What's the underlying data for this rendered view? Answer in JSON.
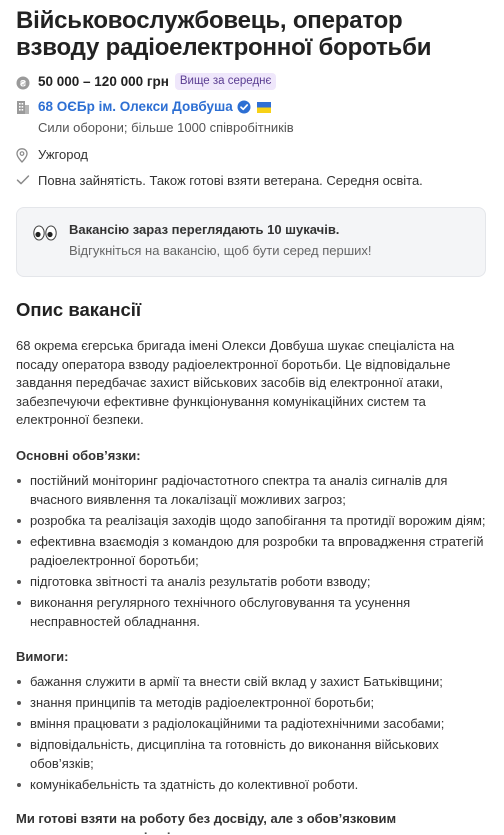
{
  "job": {
    "title": "Військовослужбовець, оператор взводу радіоелектронної боротьби",
    "salary": "50 000 – 120 000 грн",
    "salary_badge": "Вище за середнє",
    "company_name": "68 ОЄБр ім. Олекси Довбуша",
    "company_details": "Сили оборони; більше 1000 співробітників",
    "city": "Ужгород",
    "employment": "Повна зайнятість. Також готові взяти ветерана. Середня освіта."
  },
  "notice": {
    "title": "Вакансію зараз переглядають 10 шукачів.",
    "subtitle": "Відгукніться на вакансію, щоб бути серед перших!"
  },
  "description": {
    "heading": "Опис вакансії",
    "intro": "68 окрема єгерська бригада імені Олекси Довбуша шукає спеціаліста на посаду оператора взводу радіоелектронної боротьби. Це відповідальне завдання передбачає захист військових засобів від електронної атаки, забезпечуючи ефективне функціонування комунікаційних систем та електронної безпеки.",
    "duties_heading": "Основні обов’язки:",
    "duties": [
      "постійний моніторинг радіочастотного спектра та аналіз сигналів для вчасного виявлення та локалізації можливих загроз;",
      "розробка та реалізація заходів щодо запобігання та протидії ворожим діям;",
      "ефективна взаємодія з командою для розробки та впровадження стратегій радіоелектронної боротьби;",
      "підготовка звітності та аналіз результатів роботи взводу;",
      "виконання регулярного технічного обслуговування та усунення несправностей обладнання."
    ],
    "requirements_heading": "Вимоги:",
    "requirements": [
      "бажання служити в армії та внести свій вклад у захист Батьківщини;",
      "знання принципів та методів радіоелектронної боротьби;",
      "вміння працювати з радіолокаційними та радіотехнічними засобами;",
      "відповідальність, дисципліна та готовність до виконання військових обов’язків;",
      "комунікабельність та здатність до колективної роботи."
    ],
    "footer": "Ми готові взяти на роботу без досвіду, але з обов’язковим проходженням курсів підготовки."
  },
  "icons": {
    "salary": "coin-icon",
    "company": "building-icon",
    "verified": "verified-check-icon",
    "flag": "ukraine-flag-icon",
    "city": "location-pin-icon",
    "employment": "checkmark-icon",
    "notice": "eyes-icon"
  },
  "colors": {
    "link": "#2d6fd3",
    "badge_bg": "#efe7fb",
    "badge_text": "#5a3c91",
    "notice_bg": "#f4f5f7"
  }
}
